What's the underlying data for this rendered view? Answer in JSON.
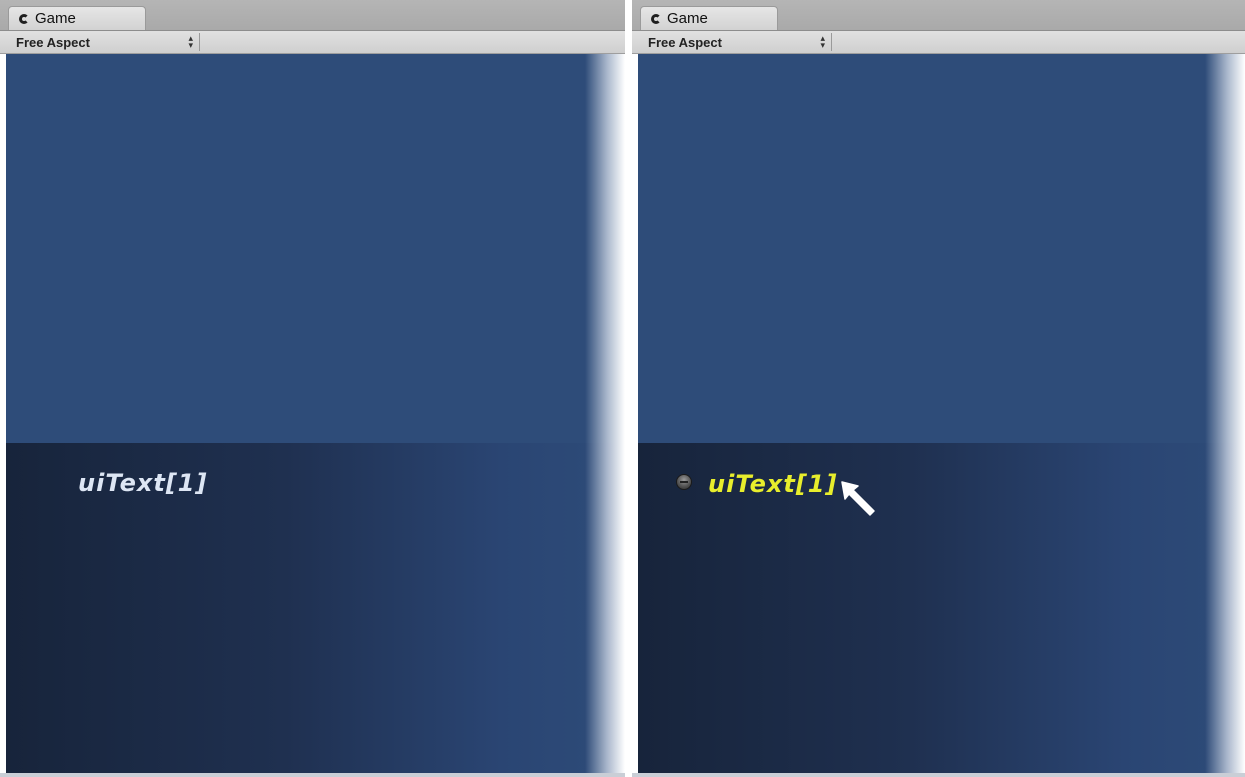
{
  "panels": [
    {
      "tab_label": "Game",
      "aspect_label": "Free Aspect",
      "ui_text": "uiText[1]"
    },
    {
      "tab_label": "Game",
      "aspect_label": "Free Aspect",
      "ui_text": "uiText[1]"
    }
  ],
  "colors": {
    "sky": "#2e4c79",
    "ground_dark": "#17243b",
    "text_normal": "#dde6f4",
    "text_hover": "#e8ee2c"
  },
  "icons": {
    "tab": "game-icon",
    "dropdown": "dropdown-arrow-icon",
    "hover_marker": "radio-icon",
    "pointer": "cursor-arrow-icon"
  }
}
